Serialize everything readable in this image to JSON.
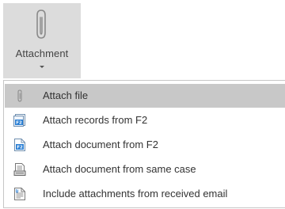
{
  "ribbon": {
    "button": {
      "label": "Attachment",
      "icon": "paperclip-icon",
      "state": "pressed"
    }
  },
  "menu": {
    "items": [
      {
        "label": "Attach file",
        "icon": "paperclip-icon",
        "highlighted": true
      },
      {
        "label": "Attach records from F2",
        "icon": "f2-records-icon",
        "highlighted": false
      },
      {
        "label": "Attach document from F2",
        "icon": "f2-document-icon",
        "highlighted": false
      },
      {
        "label": "Attach document from same case",
        "icon": "case-document-icon",
        "highlighted": false
      },
      {
        "label": "Include attachments from received email",
        "icon": "email-attachments-icon",
        "highlighted": false
      }
    ]
  },
  "colors": {
    "pressed_background": "#dcdcdc",
    "highlight_background": "#c8c8c8",
    "menu_border": "#c6c6c6",
    "f2_blue": "#2a7fd4",
    "text": "#333333"
  }
}
